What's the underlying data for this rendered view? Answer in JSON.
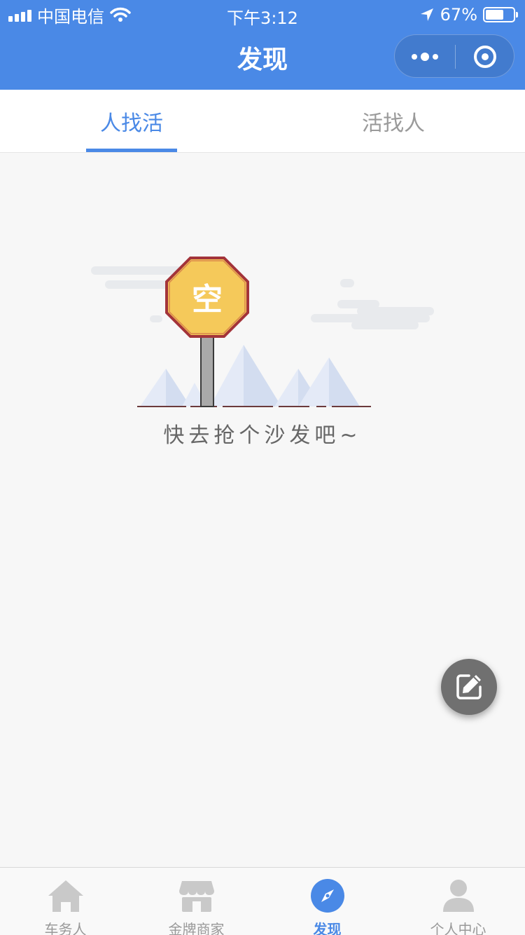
{
  "status_bar": {
    "carrier": "中国电信",
    "time": "下午3:12",
    "battery": "67%",
    "battery_level": 0.67
  },
  "nav": {
    "title": "发现"
  },
  "tabs": [
    {
      "label": "人找活",
      "active": true
    },
    {
      "label": "活找人",
      "active": false
    }
  ],
  "empty_state": {
    "sign_text": "空",
    "message": "快去抢个沙发吧~"
  },
  "bottom_tabs": [
    {
      "label": "车务人",
      "icon": "home-icon",
      "active": false
    },
    {
      "label": "金牌商家",
      "icon": "shop-icon",
      "active": false
    },
    {
      "label": "发现",
      "icon": "compass-icon",
      "active": true
    },
    {
      "label": "个人中心",
      "icon": "person-icon",
      "active": false
    }
  ],
  "colors": {
    "accent": "#4a89e6",
    "background": "#f7f7f7",
    "fab": "#707070",
    "sign_fill": "#f5c95a",
    "sign_border": "#a3343a"
  }
}
